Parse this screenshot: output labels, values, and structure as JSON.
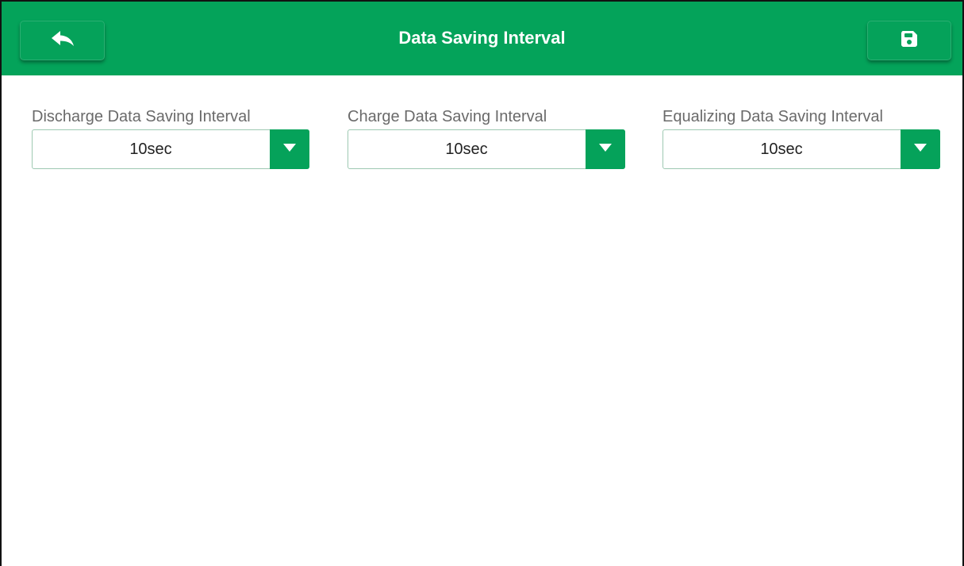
{
  "header": {
    "title": "Data Saving Interval",
    "back_icon": "back-arrow-icon",
    "save_icon": "save-icon",
    "background_color": "#04a35a"
  },
  "fields": [
    {
      "label": "Discharge Data Saving Interval",
      "value": "10sec"
    },
    {
      "label": "Charge Data Saving Interval",
      "value": "10sec"
    },
    {
      "label": "Equalizing Data Saving Interval",
      "value": "10sec"
    }
  ]
}
